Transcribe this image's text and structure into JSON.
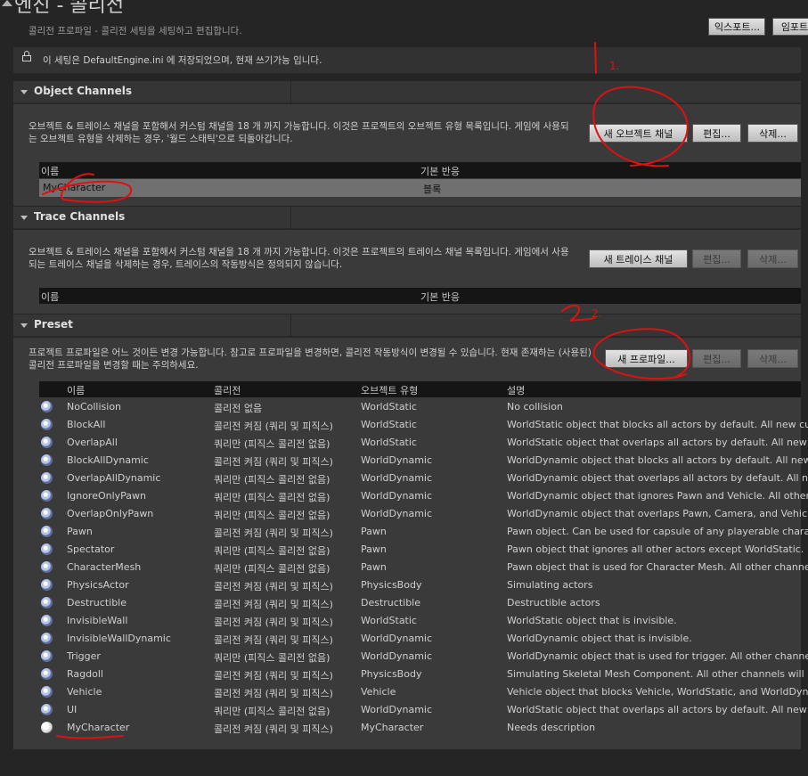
{
  "header": {
    "title": "엔진 - 콜리전",
    "subtitle": "콜리전 프로파일 - 콜리전 세팅을 세팅하고 편집합니다.",
    "export_label": "익스포트...",
    "import_label": "임포트"
  },
  "notice": {
    "text": "이 세팅은 DefaultEngine.ini 에 저장되었으며, 현재 쓰기가능 입니다."
  },
  "object_channels": {
    "title": "Object Channels",
    "description": "오브젝트 & 트레이스 채널을 포함해서 커스텀 채널을 18 개 까지 가능합니다. 이것은 프로젝트의 오브젝트 유형 목록입니다. 게임에 사용되는 오브젝트 유형을 삭제하는 경우, '월드 스태틱'으로 되돌아갑니다.",
    "new_label": "새 오브젝트 채널",
    "edit_label": "편집...",
    "delete_label": "삭제...",
    "col_name": "이름",
    "col_response": "기본 반응",
    "rows": [
      {
        "name": "MyCharacter",
        "response": "블록"
      }
    ]
  },
  "trace_channels": {
    "title": "Trace Channels",
    "description": "오브젝트 & 트레이스 채널을 포함해서 커스텀 채널을 18 개 까지 가능합니다. 이것은 프로젝트의 트레이스 채널 목록입니다. 게임에서 사용되는 트레이스 채널을 삭제하는 경우, 트레이스의 작동방식은 정의되지 않습니다.",
    "new_label": "새 트레이스 채널",
    "edit_label": "편집...",
    "delete_label": "삭제...",
    "col_name": "이름",
    "col_response": "기본 반응"
  },
  "preset": {
    "title": "Preset",
    "description": "프로젝트 프로파일은 어느 것이든 변경 가능합니다. 참고로 프로파일을 변경하면, 콜리전 작동방식이 변경될 수 있습니다. 현재 존재하는 (사용된) 콜리전 프로파일을 변경할 때는 주의하세요.",
    "new_label": "새 프로파일...",
    "edit_label": "편집...",
    "delete_label": "삭제...",
    "columns": [
      "이름",
      "콜리전",
      "오브젝트 유형",
      "설명"
    ],
    "rows": [
      {
        "name": "NoCollision",
        "collision": "콜리전 없음",
        "type": "WorldStatic",
        "desc": "No collision"
      },
      {
        "name": "BlockAll",
        "collision": "콜리전 켜짐 (쿼리 및 피직스)",
        "type": "WorldStatic",
        "desc": "WorldStatic object that blocks all actors by default. All new custor"
      },
      {
        "name": "OverlapAll",
        "collision": "쿼리만 (피직스 콜리전 없음)",
        "type": "WorldStatic",
        "desc": "WorldStatic object that overlaps all actors by default. All new cust"
      },
      {
        "name": "BlockAllDynamic",
        "collision": "콜리전 켜짐 (쿼리 및 피직스)",
        "type": "WorldDynamic",
        "desc": "WorldDynamic object that blocks all actors by default. All new cus"
      },
      {
        "name": "OverlapAllDynamic",
        "collision": "쿼리만 (피직스 콜리전 없음)",
        "type": "WorldDynamic",
        "desc": "WorldDynamic object that overlaps all actors by default. All new cu"
      },
      {
        "name": "IgnoreOnlyPawn",
        "collision": "쿼리만 (피직스 콜리전 없음)",
        "type": "WorldDynamic",
        "desc": "WorldDynamic object that ignores Pawn and Vehicle. All other cha"
      },
      {
        "name": "OverlapOnlyPawn",
        "collision": "쿼리만 (피직스 콜리전 없음)",
        "type": "WorldDynamic",
        "desc": "WorldDynamic object that overlaps Pawn, Camera, and Vehicle. All c"
      },
      {
        "name": "Pawn",
        "collision": "콜리전 켜짐 (쿼리 및 피직스)",
        "type": "Pawn",
        "desc": "Pawn object. Can be used for capsule of any playerable character"
      },
      {
        "name": "Spectator",
        "collision": "쿼리만 (피직스 콜리전 없음)",
        "type": "Pawn",
        "desc": "Pawn object that ignores all other actors except WorldStatic."
      },
      {
        "name": "CharacterMesh",
        "collision": "쿼리만 (피직스 콜리전 없음)",
        "type": "Pawn",
        "desc": "Pawn object that is used for Character Mesh. All other channels w"
      },
      {
        "name": "PhysicsActor",
        "collision": "콜리전 켜짐 (쿼리 및 피직스)",
        "type": "PhysicsBody",
        "desc": "Simulating actors"
      },
      {
        "name": "Destructible",
        "collision": "콜리전 켜짐 (쿼리 및 피직스)",
        "type": "Destructible",
        "desc": "Destructible actors"
      },
      {
        "name": "InvisibleWall",
        "collision": "콜리전 켜짐 (쿼리 및 피직스)",
        "type": "WorldStatic",
        "desc": "WorldStatic object that is invisible."
      },
      {
        "name": "InvisibleWallDynamic",
        "collision": "콜리전 켜짐 (쿼리 및 피직스)",
        "type": "WorldDynamic",
        "desc": "WorldDynamic object that is invisible."
      },
      {
        "name": "Trigger",
        "collision": "쿼리만 (피직스 콜리전 없음)",
        "type": "WorldDynamic",
        "desc": "WorldDynamic object that is used for trigger. All other channels wi"
      },
      {
        "name": "Ragdoll",
        "collision": "콜리전 켜짐 (쿼리 및 피직스)",
        "type": "PhysicsBody",
        "desc": "Simulating Skeletal Mesh Component. All other channels will be s"
      },
      {
        "name": "Vehicle",
        "collision": "콜리전 켜짐 (쿼리 및 피직스)",
        "type": "Vehicle",
        "desc": "Vehicle object that blocks Vehicle, WorldStatic, and WorldDynamic"
      },
      {
        "name": "UI",
        "collision": "쿼리만 (피직스 콜리전 없음)",
        "type": "WorldDynamic",
        "desc": "WorldStatic object that overlaps all actors by default. All new cust"
      },
      {
        "name": "MyCharacter",
        "collision": "콜리전 켜짐 (쿼리 및 피직스)",
        "type": "MyCharacter",
        "desc": "Needs description"
      }
    ]
  },
  "annotations": {
    "mark1": "1.",
    "mark2": "2.",
    "ink_color": "#e01010"
  }
}
